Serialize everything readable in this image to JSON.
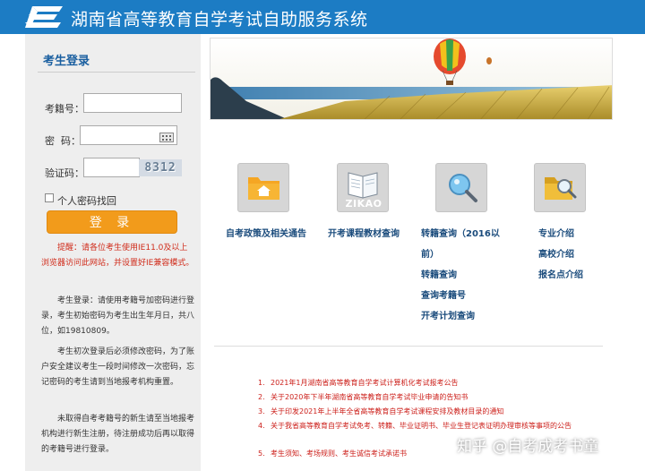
{
  "header": {
    "title": "湖南省高等教育自学考试自助服务系统",
    "bg_color": "#1c7cc4"
  },
  "login": {
    "heading": "考生登录",
    "id_label": "考籍号：",
    "id_value": "",
    "password_label": "密  码：",
    "password_value": "",
    "captcha_label": "验证码：",
    "captcha_value": "",
    "captcha_image_text": "8312",
    "recover_label": "个人密码找回",
    "login_button": "登 录",
    "notice_browser": "提醒：请各位考生使用IE11.0及以上浏览器访问此网站，并设置好IE兼容模式。",
    "notice_login": "考生登录：请使用考籍号加密码进行登录，考生初始密码为考生出生年月日，共八位，如19810809。",
    "notice_first": "考生初次登录后必须修改密码，为了账户安全建议考生一段时间修改一次密码，忘记密码的考生请到当地报考机构重置。",
    "notice_number": "未取得自考考籍号的新生请至当地报考机构进行新生注册，待注册成功后再以取得的考籍号进行登录。"
  },
  "nav": {
    "policy_link": "自考政策及相关通告",
    "textbook_link": "开考课程教材查询",
    "transfer_link_line1": "转籍查询（2016以",
    "transfer_link_line2": "前）",
    "transfer_query": "转籍查询",
    "search_number": "查询考籍号",
    "exam_plan": "开考计划查询",
    "major_intro": "专业介绍",
    "college_intro": "高校介绍",
    "site_intro": "报名点介绍",
    "zikao_label": "ZIKAO"
  },
  "announcements": [
    {
      "num": "1.",
      "text": "2021年1月湖南省高等教育自学考试计算机化考试报考公告"
    },
    {
      "num": "2.",
      "text": "关于2020年下半年湖南省高等教育自学考试毕业申请的告知书"
    },
    {
      "num": "3.",
      "text": "关于印发2021年上半年全省高等教育自学考试课程安排及教材目录的通知"
    },
    {
      "num": "4.",
      "text": "关于我省高等教育自学考试免考、转籍、毕业证明书、毕业生登记表证明办理审核等事项的公告"
    },
    {
      "num": "5.",
      "text": "考生须知、考场规则、考生诚信考试承诺书"
    }
  ],
  "watermark": "知乎 @自考成考书童",
  "colors": {
    "accent": "#1c7cc4",
    "login_button": "#f29b1b",
    "notice_red": "#d02b1a",
    "link_blue": "#1a4b7c"
  }
}
